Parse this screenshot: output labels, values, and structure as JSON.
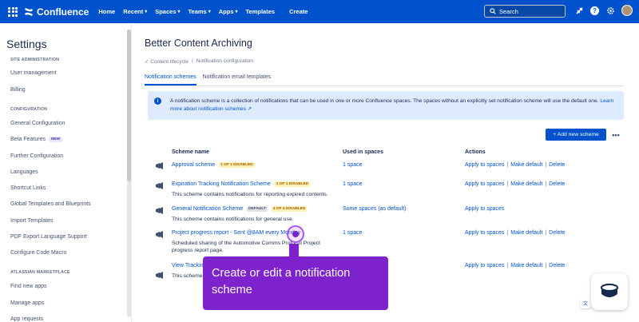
{
  "topnav": {
    "product": "Confluence",
    "items": [
      {
        "label": "Home",
        "chevron": false
      },
      {
        "label": "Recent",
        "chevron": true
      },
      {
        "label": "Spaces",
        "chevron": true
      },
      {
        "label": "Teams",
        "chevron": true
      },
      {
        "label": "Apps",
        "chevron": true
      },
      {
        "label": "Templates",
        "chevron": false
      }
    ],
    "create_label": "Create",
    "search_placeholder": "Search",
    "brand_color": "#0052cc"
  },
  "sidebar": {
    "title": "Settings",
    "sections": [
      {
        "heading": "SITE ADMINISTRATION",
        "items": [
          "User management",
          "Billing"
        ]
      },
      {
        "heading": "CONFIGURATION",
        "items": [
          "General Configuration",
          "Beta Features",
          "Further Configuration",
          "Languages",
          "Shortcut Links",
          "Global Templates and Blueprints",
          "Import Templates",
          "PDF Export Language Support",
          "Configure Code Macro"
        ]
      },
      {
        "heading": "ATLASSIAN MARKETPLACE",
        "items": [
          "Find new apps",
          "Manage apps",
          "App requests"
        ]
      }
    ],
    "new_badge": "NEW"
  },
  "main": {
    "title": "Better Content Archiving",
    "breadcrumb": [
      "Content lifecycle",
      "/",
      "Notification configuration"
    ],
    "tabs": [
      "Notification schemes",
      "Notification email templates"
    ],
    "banner_text": "A notification scheme is a collection of notifications that can be used in one or more Confluence spaces. The spaces without an explicitly set notification scheme will use the default one.",
    "banner_link": "Learn more about notification schemes",
    "add_button": "+ Add new scheme",
    "more_button": "•••",
    "columns": [
      "Scheme name",
      "Used in spaces",
      "Actions"
    ],
    "rows": [
      {
        "name": "Approval scheme",
        "badges": [
          "1 OF 1 DISABLED"
        ],
        "desc": "",
        "spaces": "1 space",
        "actions": [
          "Apply to spaces",
          "Make default",
          "Delete"
        ]
      },
      {
        "name": "Expiration Tracking Notification Scheme",
        "badges": [
          "1 OF 1 DISABLED"
        ],
        "desc": "This scheme contains notifications for reporting expired contents.",
        "spaces": "1 space",
        "actions": [
          "Apply to spaces",
          "Make default",
          "Delete"
        ]
      },
      {
        "name": "General Notification Scheme",
        "badges": [
          "DEFAULT",
          "4 OF 4 DISABLED"
        ],
        "desc": "This scheme contains notifications for general use.",
        "spaces": "Some spaces (as default)",
        "actions": [
          "Apply to spaces"
        ]
      },
      {
        "name": "Project progress report - Sent @8AM every Monday",
        "badges": [],
        "desc": "Scheduled sharing of the Automotive Comms Protocol Project progress report page.",
        "spaces": "1 space",
        "actions": [
          "Apply to spaces",
          "Make default",
          "Delete"
        ]
      },
      {
        "name": "View Tracking",
        "badges": [],
        "desc": "This scheme ... contents.",
        "spaces": "",
        "actions": [
          "Apply to spaces",
          "Make default",
          "Delete"
        ]
      }
    ]
  },
  "tooltip": {
    "text": "Create or edit a notification scheme",
    "color": "#7e22ce"
  }
}
